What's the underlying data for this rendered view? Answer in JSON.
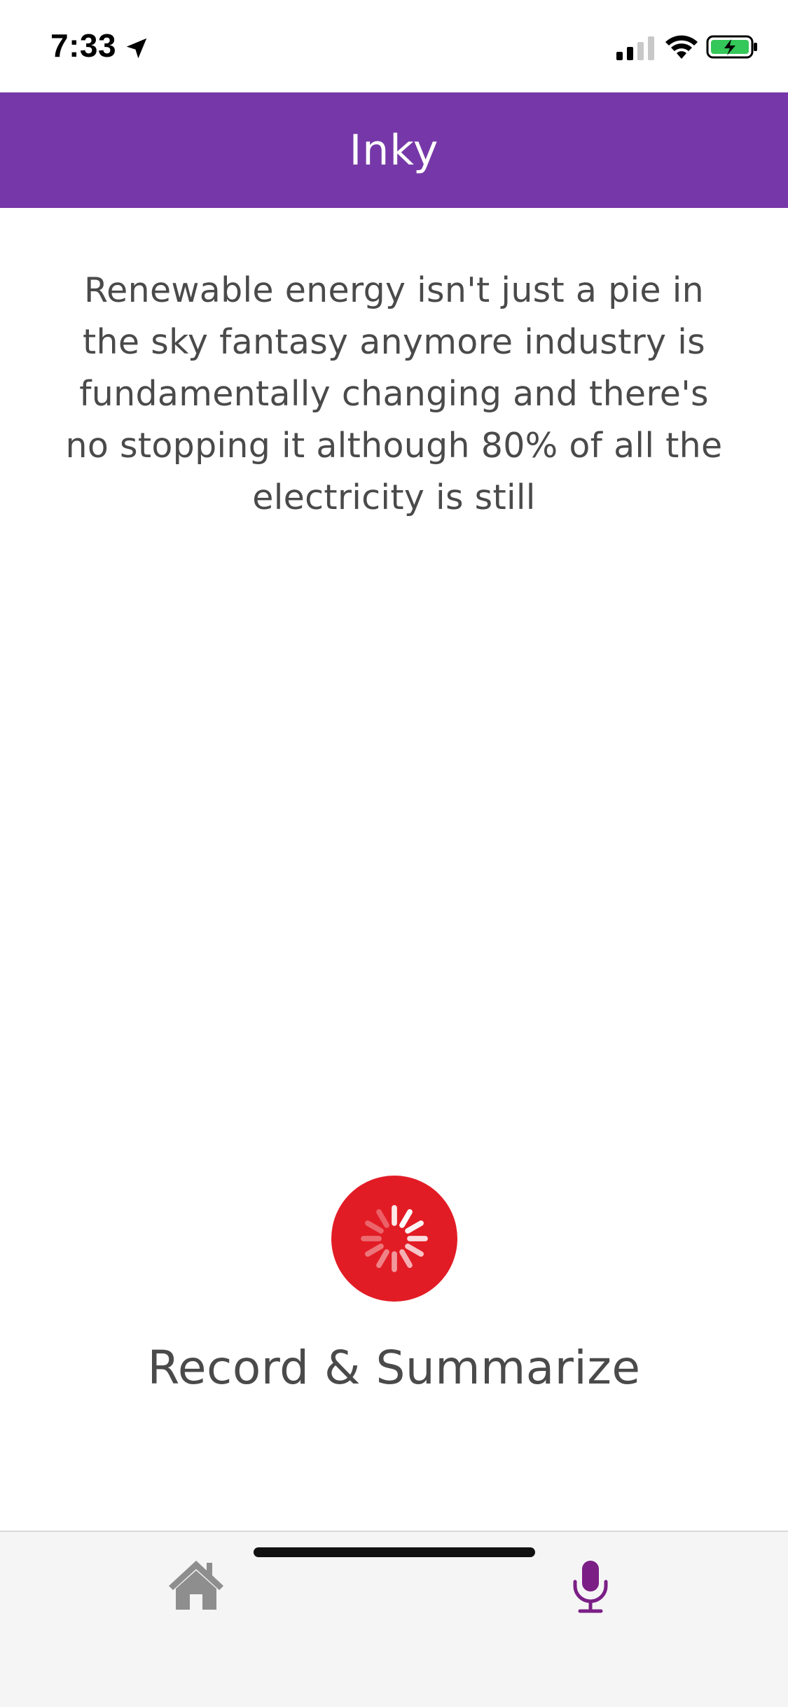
{
  "status_bar": {
    "time": "7:33",
    "location_icon": "location-arrow-icon",
    "signal_icon": "cellular-signal-icon",
    "wifi_icon": "wifi-icon",
    "battery_icon": "battery-charging-icon"
  },
  "header": {
    "title": "Inky",
    "background_color": "#7638a8"
  },
  "transcript": {
    "text": "Renewable energy isn't just a pie in the sky fantasy anymore industry is fundamentally changing and there's no stopping it although 80% of all the electricity is still"
  },
  "record": {
    "icon": "loading-spinner-icon",
    "button_color": "#e21c25",
    "label": "Record & Summarize"
  },
  "tab_bar": {
    "tabs": [
      {
        "name": "home",
        "icon": "home-icon",
        "active": false,
        "color": "#8e8e8e"
      },
      {
        "name": "record",
        "icon": "microphone-icon",
        "active": true,
        "color": "#7b1f86"
      }
    ]
  }
}
